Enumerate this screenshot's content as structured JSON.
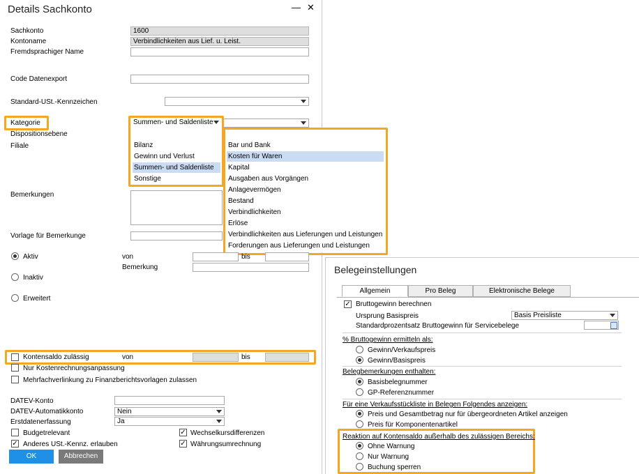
{
  "details": {
    "title": "Details Sachkonto",
    "minimize": "—",
    "close": "✕",
    "sachkonto_label": "Sachkonto",
    "sachkonto_value": "1600",
    "kontoname_label": "Kontoname",
    "kontoname_value": "Verbindlichkeiten aus Lief. u. Leist.",
    "fremd_label": "Fremdsprachiger Name",
    "code_label": "Code Datenexport",
    "ust_label": "Standard-USt.-Kennzeichen",
    "kategorie_label": "Kategorie",
    "kategorie_value": "Summen- und Saldenliste",
    "dispo_label": "Dispositionsebene",
    "filiale_label": "Filiale",
    "bemerkungen_label": "Bemerkungen",
    "vorlage_label": "Vorlage für Bemerkunge",
    "aktiv_label": "Aktiv",
    "von_label": "von",
    "bis_label": "bis",
    "bemerkung_label": "Bemerkung",
    "inaktiv_label": "Inaktiv",
    "erweitert_label": "Erweitert",
    "kontensaldo_label": "Kontensaldo zulässig",
    "kontensaldo_von": "von",
    "kontensaldo_bis": "bis",
    "nur_kosten_label": "Nur Kostenrechnungsanpassung",
    "mehrfach_label": "Mehrfachverlinkung zu Finanzberichtsvorlagen zulassen",
    "datev_konto_label": "DATEV-Konto",
    "datev_auto_label": "DATEV-Automatikkonto",
    "datev_auto_value": "Nein",
    "erstdaten_label": "Erstdatenerfassung",
    "erstdaten_value": "Ja",
    "budget_label": "Budgetrelevant",
    "wechsel_label": "Wechselkursdifferenzen",
    "anderes_label": "Anderes USt.-Kennz. erlauben",
    "waehrung_label": "Währungsumrechnung",
    "ok_label": "OK",
    "abbrechen_label": "Abbrechen",
    "kategorie_options": [
      "Bilanz",
      "Gewinn und Verlust",
      "Summen- und Saldenliste",
      "Sonstige"
    ],
    "dispo_options": [
      "Bar und Bank",
      "Kosten für Waren",
      "Kapital",
      "Ausgaben aus Vorgängen",
      "Anlagevermögen",
      "Bestand",
      "Verbindlichkeiten",
      "Erlöse",
      "Verbindlichkeiten aus Lieferungen und Leistungen",
      "Forderungen aus Lieferungen und Leistungen"
    ]
  },
  "belege": {
    "title": "Belegeinstellungen",
    "tabs": [
      "Allgemein",
      "Pro Beleg",
      "Elektronische Belege"
    ],
    "brutto_label": "Bruttogewinn berechnen",
    "ursprung_label": "Ursprung Basispreis",
    "ursprung_value": "Basis Preisliste",
    "standard_label": "Standardprozentsatz Bruttogewinn für Servicebelege",
    "pct_heading": "% Bruttogewinn ermitteln als:",
    "pct_opt1": "Gewinn/Verkaufspreis",
    "pct_opt2": "Gewinn/Basispreis",
    "beleg_heading": "Belegbemerkungen enthalten:",
    "beleg_opt1": "Basisbelegnummer",
    "beleg_opt2": "GP-Referenznummer",
    "vk_heading": "Für eine Verkaufsstückliste in Belegen Folgendes anzeigen:",
    "vk_opt1": "Preis und Gesamtbetrag nur für übergeordneten Artikel anzeigen",
    "vk_opt2": "Preis für Komponentenartikel",
    "reaktion_heading": "Reaktion auf Kontensaldo außerhalb des zulässigen Bereichs:",
    "reaktion_opt1": "Ohne Warnung",
    "reaktion_opt2": "Nur Warnung",
    "reaktion_opt3": "Buchung sperren"
  },
  "colors": {
    "highlight": "#f5a623",
    "ok_button": "#1e90e6",
    "cancel_button": "#7a7a7a",
    "selection": "#c9dcf3"
  }
}
